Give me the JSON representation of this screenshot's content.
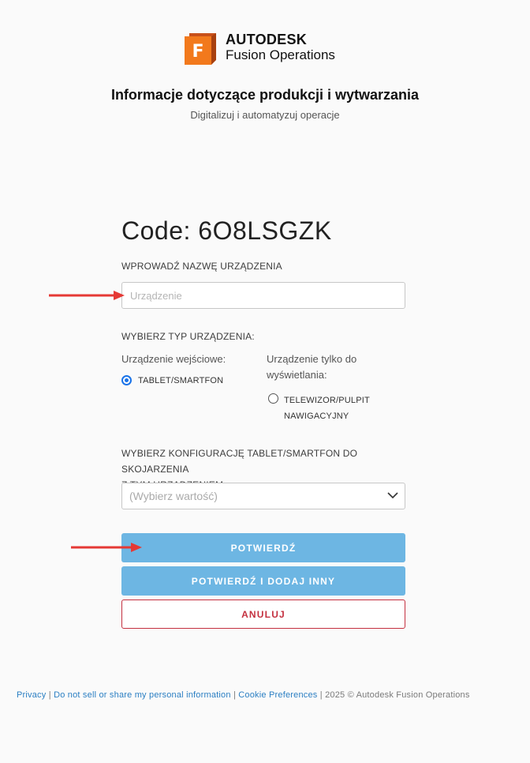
{
  "brand": {
    "company": "AUTODESK",
    "product": "Fusion Operations"
  },
  "hero": {
    "title": "Informacje dotyczące produkcji i wytwarzania",
    "subtitle": "Digitalizuj i automatyzuj operacje"
  },
  "form": {
    "code": "Code: 6O8LSGZK",
    "device_name_label": "WPROWADŹ NAZWĘ URZĄDZENIA",
    "device_name_placeholder": "Urządzenie",
    "device_name_value": "",
    "device_type_label": "WYBIERZ TYP URZĄDZENIA:",
    "input_device": {
      "label": "Urządzenie wejściowe:",
      "option": "TABLET/SMARTFON",
      "checked": true
    },
    "display_device": {
      "label_line1": "Urządzenie tylko do",
      "label_line2": "wyświetlania:",
      "option_line1": "TELEWIZOR/PULPIT",
      "option_line2": "NAWIGACYJNY",
      "checked": false
    },
    "config_label_line1": "WYBIERZ KONFIGURACJĘ TABLET/SMARTFON DO SKOJARZENIA",
    "config_label_line2": "Z TYM URZĄDZENIEM:",
    "config_placeholder": "(Wybierz wartość)",
    "confirm_label": "POTWIERDŹ",
    "confirm_add_label": "POTWIERDŹ I DODAJ INNY",
    "cancel_label": "ANULUJ"
  },
  "footer": {
    "privacy": "Privacy",
    "do_not_sell": "Do not sell or share my personal information",
    "cookies": "Cookie Preferences",
    "separator": "|",
    "copyright": "2025 © Autodesk Fusion Operations"
  },
  "colors": {
    "primary_button": "#6db6e3",
    "cancel": "#c4303f",
    "annotation_arrow": "#e53935",
    "link": "#2b7fc3",
    "logo_orange": "#f2791c"
  }
}
